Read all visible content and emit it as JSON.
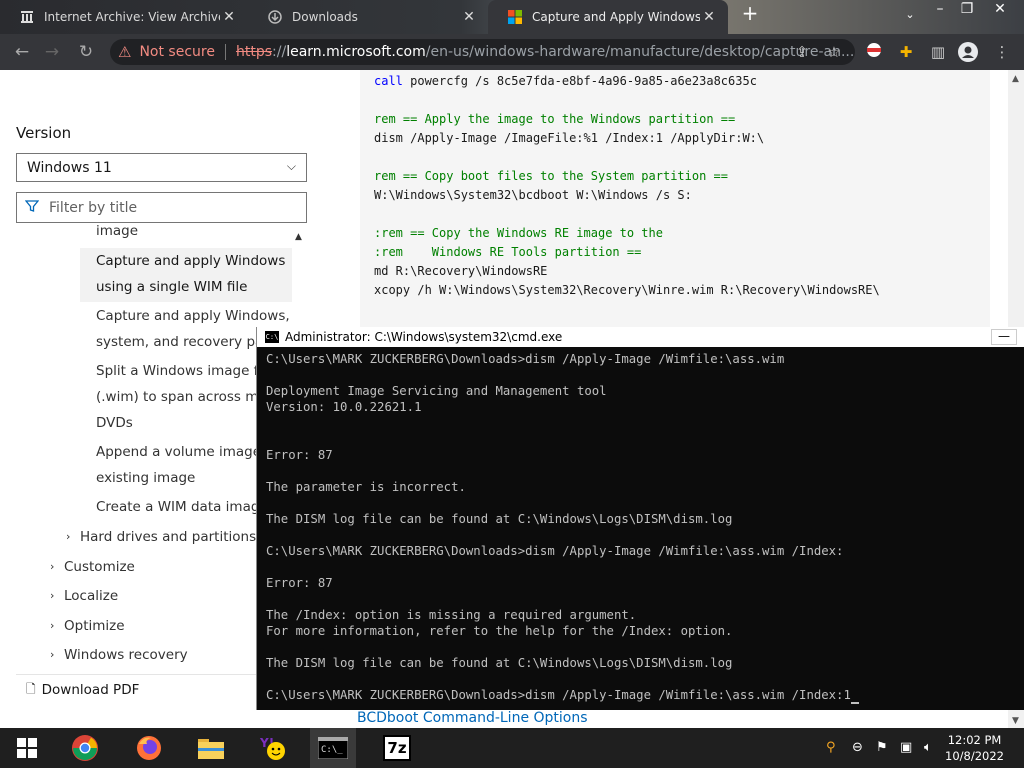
{
  "browser": {
    "tabs": [
      {
        "title": "Internet Archive: View Archive",
        "close": "✕"
      },
      {
        "title": "Downloads",
        "close": "✕"
      },
      {
        "title": "Capture and Apply Windows using",
        "close": "✕"
      }
    ],
    "new_tab": "+",
    "window_controls": {
      "min": "–",
      "restore": "❐",
      "close": "✕"
    },
    "address": {
      "warning": "Not secure",
      "scheme": "https",
      "sep": "://",
      "host": "learn.microsoft.com",
      "path": "/en-us/windows-hardware/manufacture/desktop/capture-an..."
    }
  },
  "page": {
    "version_label": "Version",
    "version_value": "Windows 11",
    "filter_placeholder": "Filter by title",
    "toc": {
      "partial": "image",
      "selected_1": "Capture and apply Windows",
      "selected_2": "using a single WIM file",
      "i1a": "Capture and apply Windows,",
      "i1b": "system, and recovery partit",
      "i2a": "Split a Windows image file",
      "i2b": "(.wim) to span across multi",
      "i2c": "DVDs",
      "i3a": "Append a volume image to",
      "i3b": "existing image",
      "i4": "Create a WIM data image",
      "hard_drives": "Hard drives and partitions",
      "customize": "Customize",
      "localize": "Localize",
      "optimize": "Optimize",
      "windows_recovery": "Windows recovery"
    },
    "download_pdf": "Download PDF",
    "bcd_link": "BCDboot Command-Line Options",
    "code": {
      "l1": "call powercfg /s 8c5e7fda-e8bf-4a96-9a85-a6e23a8c635c",
      "l2": "rem == Apply the image to the Windows partition ==",
      "l3": "dism /Apply-Image /ImageFile:%1 /Index:1 /ApplyDir:W:\\",
      "l4": "rem == Copy boot files to the System partition ==",
      "l5": "W:\\Windows\\System32\\bcdboot W:\\Windows /s S:",
      "l6": ":rem == Copy the Windows RE image to the",
      "l7": ":rem    Windows RE Tools partition ==",
      "l8": "md R:\\Recovery\\WindowsRE",
      "l9": "xcopy /h W:\\Windows\\System32\\Recovery\\Winre.wim R:\\Recovery\\WindowsRE\\"
    }
  },
  "cmd": {
    "title": "Administrator: C:\\Windows\\system32\\cmd.exe",
    "minimize": "—",
    "lines": [
      "C:\\Users\\MARK ZUCKERBERG\\Downloads>dism /Apply-Image /Wimfile:\\ass.wim",
      "",
      "Deployment Image Servicing and Management tool",
      "Version: 10.0.22621.1",
      "",
      "",
      "Error: 87",
      "",
      "The parameter is incorrect.",
      "",
      "The DISM log file can be found at C:\\Windows\\Logs\\DISM\\dism.log",
      "",
      "C:\\Users\\MARK ZUCKERBERG\\Downloads>dism /Apply-Image /Wimfile:\\ass.wim /Index:",
      "",
      "Error: 87",
      "",
      "The /Index: option is missing a required argument.",
      "For more information, refer to the help for the /Index: option.",
      "",
      "The DISM log file can be found at C:\\Windows\\Logs\\DISM\\dism.log",
      "",
      "C:\\Users\\MARK ZUCKERBERG\\Downloads>dism /Apply-Image /Wimfile:\\ass.wim /Index:1"
    ]
  },
  "taskbar": {
    "clock_time": "12:02 PM",
    "clock_date": "10/8/2022",
    "app_7zip": "7z"
  },
  "colors": {
    "code_keyword": "#0000ff",
    "code_comment": "#008000",
    "link": "#0067b8",
    "not_secure": "#f28b82"
  }
}
